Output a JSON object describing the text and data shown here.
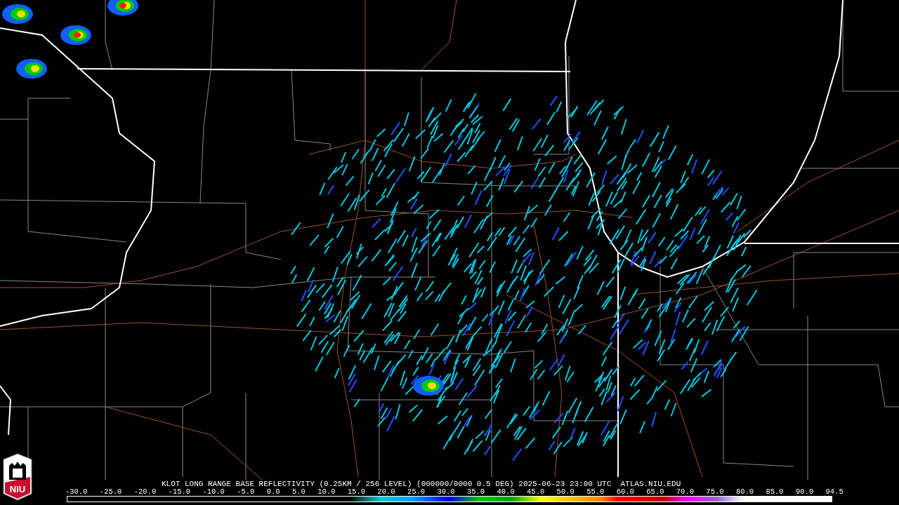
{
  "logo": {
    "text": "NIU"
  },
  "legend": {
    "title": "KLOT LONG RANGE BASE REFLECTIVITY (0.25KM / 256 LEVEL) (000000/0000 0.5 DEG) 2025-06-23 23:00 UTC  ATLAS.NIU.EDU",
    "ticks": [
      "-30.0",
      "-25.0",
      "-20.0",
      "-15.0",
      "-10.0",
      "-5.0",
      "0.0",
      "5.0",
      "10.0",
      "15.0",
      "20.0",
      "25.0",
      "30.0",
      "35.0",
      "40.0",
      "45.0",
      "50.0",
      "55.0",
      "60.0",
      "65.0",
      "70.0",
      "75.0",
      "80.0",
      "85.0",
      "90.0",
      "94.5"
    ]
  }
}
